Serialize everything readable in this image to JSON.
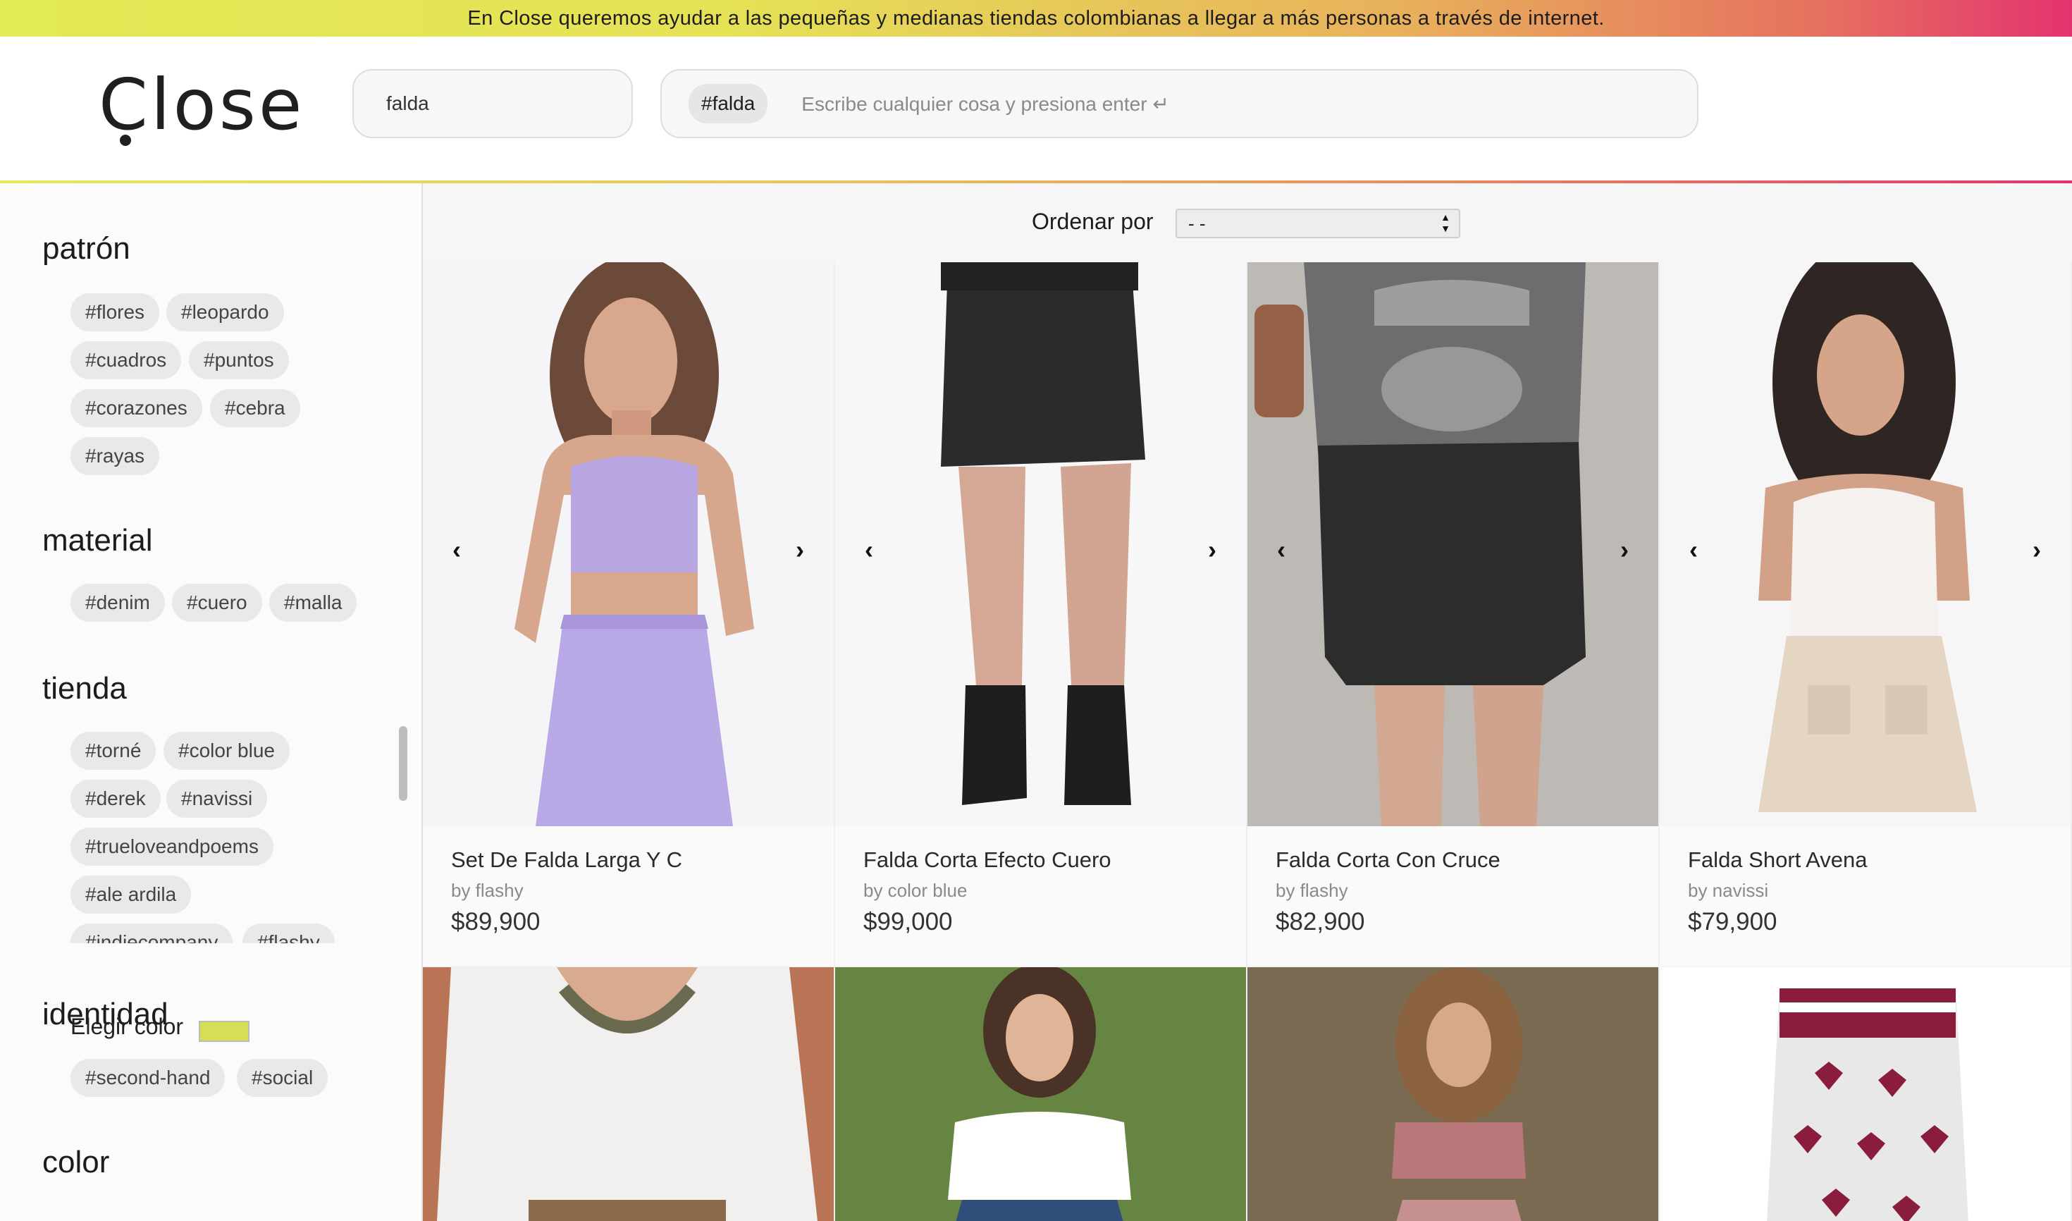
{
  "banner": {
    "text": "En Close queremos ayudar a las pequeñas y medianas tiendas colombianas a llegar a más personas a través de internet."
  },
  "header": {
    "logo": "Close",
    "search_value": "falda",
    "active_tag": "#falda",
    "tag_placeholder": "Escribe cualquier cosa y presiona enter ↵"
  },
  "sidebar": {
    "sections": [
      {
        "title": "patrón",
        "tags": [
          "#flores",
          "#leopardo",
          "#cuadros",
          "#puntos",
          "#corazones",
          "#cebra",
          "#rayas"
        ]
      },
      {
        "title": "material",
        "tags": [
          "#denim",
          "#cuero",
          "#malla"
        ]
      },
      {
        "title": "tienda",
        "tags": [
          "#torné",
          "#color blue",
          "#derek",
          "#navissi",
          "#trueloveandpoems",
          "#ale ardila",
          "#indiecompany",
          "#flashy"
        ]
      },
      {
        "title": "identidad",
        "tags": [
          "#second-hand",
          "#social"
        ]
      },
      {
        "title": "color",
        "tags": []
      }
    ],
    "color_picker_label": "Elegir color",
    "color_picker_value": "#d7de55"
  },
  "sort": {
    "label": "Ordenar por",
    "selected": "- -"
  },
  "products": [
    {
      "name": "Set De Falda Larga Y C",
      "store": "by flashy",
      "price": "$89,900"
    },
    {
      "name": "Falda Corta Efecto Cuero",
      "store": "by color blue",
      "price": "$99,000"
    },
    {
      "name": "Falda Corta Con Cruce",
      "store": "by flashy",
      "price": "$82,900"
    },
    {
      "name": "Falda Short Avena",
      "store": "by navissi",
      "price": "$79,900"
    }
  ],
  "carousel": {
    "prev_icon": "chevron-left-icon",
    "next_icon": "chevron-right-icon"
  },
  "colors": {
    "banner_start": "#e2ea55",
    "banner_end": "#e3336f"
  }
}
